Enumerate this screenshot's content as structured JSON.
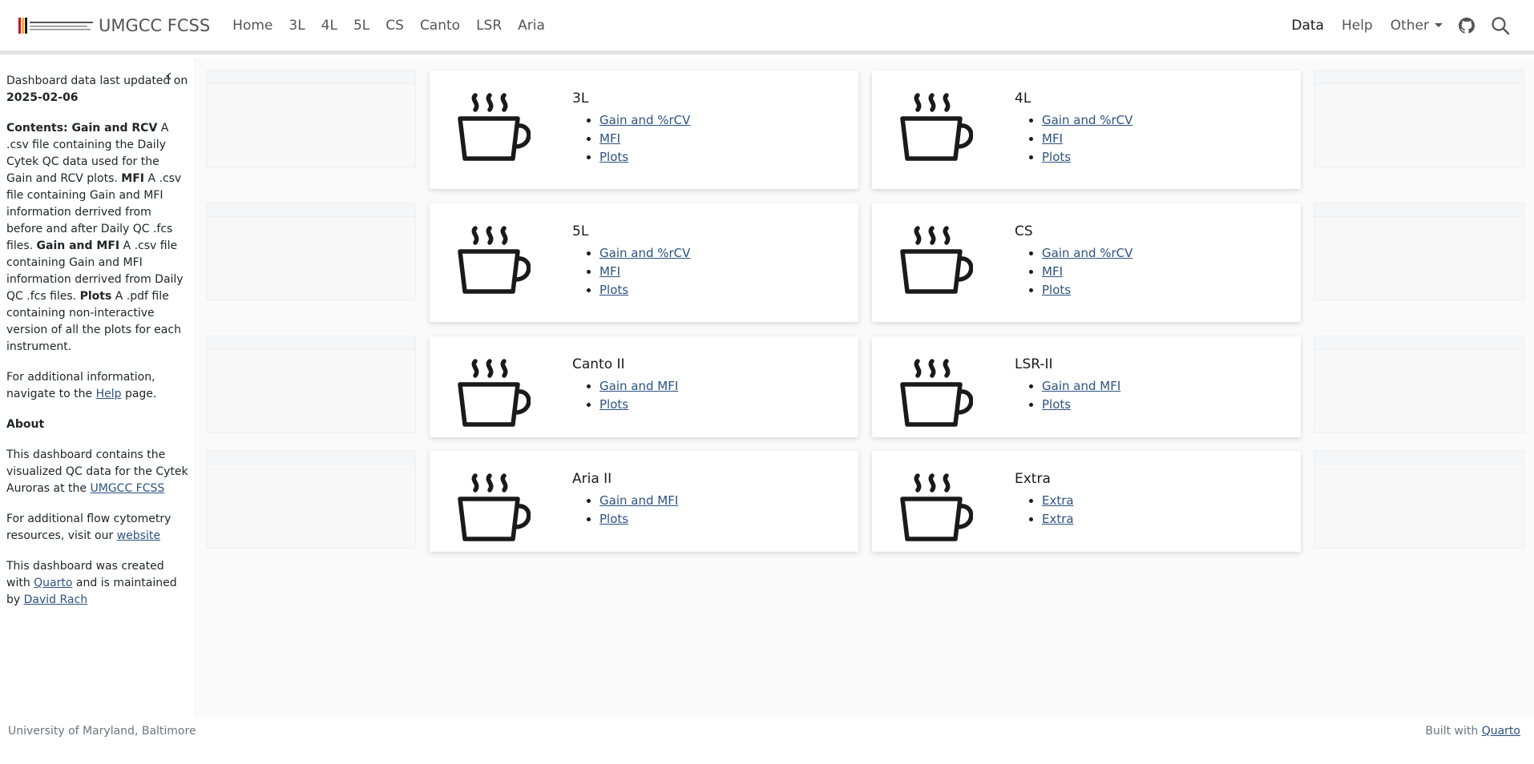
{
  "navbar": {
    "logo_text": "University of Maryland",
    "title": "UMGCC FCSS",
    "links": [
      "Home",
      "3L",
      "4L",
      "5L",
      "CS",
      "Canto",
      "LSR",
      "Aria"
    ],
    "right_links": {
      "data": "Data",
      "help": "Help",
      "other": "Other"
    }
  },
  "sidebar": {
    "updated_prefix": "Dashboard data last updated on",
    "updated_date": "2025-02-06",
    "contents": {
      "label1": "Contents: Gain and RCV",
      "text1": " A .csv file containing the Daily Cytek QC data used for the Gain and RCV plots. ",
      "label2": "MFI",
      "text2": " A .csv file containing Gain and MFI information derrived from before and after Daily QC .fcs files. ",
      "label3": "Gain and MFI",
      "text3": " A .csv file containing Gain and MFI information derrived from Daily QC .fcs files. ",
      "label4": "Plots",
      "text4": " A .pdf file containing non-interactive version of all the plots for each instrument."
    },
    "additional": {
      "prefix": "For additional information, navigate to the ",
      "link": "Help",
      "suffix": " page."
    },
    "about_heading": "About",
    "about": {
      "prefix": "This dashboard contains the visualized QC data for the Cytek Auroras at the ",
      "link": "UMGCC FCSS"
    },
    "resources": {
      "prefix": "For additional flow cytometry resources, visit our ",
      "link": "website"
    },
    "created": {
      "prefix": "This dashboard was created with ",
      "link1": "Quarto",
      "middle": " and is maintained by ",
      "link2": "David Rach"
    }
  },
  "cards": [
    {
      "title": "3L",
      "links": [
        "Gain and %rCV",
        "MFI",
        "Plots"
      ]
    },
    {
      "title": "4L",
      "links": [
        "Gain and %rCV",
        "MFI",
        "Plots"
      ]
    },
    {
      "title": "5L",
      "links": [
        "Gain and %rCV",
        "MFI",
        "Plots"
      ]
    },
    {
      "title": "CS",
      "links": [
        "Gain and %rCV",
        "MFI",
        "Plots"
      ]
    },
    {
      "title": "Canto II",
      "links": [
        "Gain and MFI",
        "Plots"
      ]
    },
    {
      "title": "LSR-II",
      "links": [
        "Gain and MFI",
        "Plots"
      ]
    },
    {
      "title": "Aria II",
      "links": [
        "Gain and MFI",
        "Plots"
      ]
    },
    {
      "title": "Extra",
      "links": [
        "Extra",
        "Extra"
      ]
    }
  ],
  "footer": {
    "left": "University of Maryland, Baltimore",
    "right_prefix": "Built with ",
    "right_link": "Quarto"
  },
  "colors": {
    "link": "#2c5282",
    "nav_text": "#545454",
    "background": "#fafafa"
  }
}
